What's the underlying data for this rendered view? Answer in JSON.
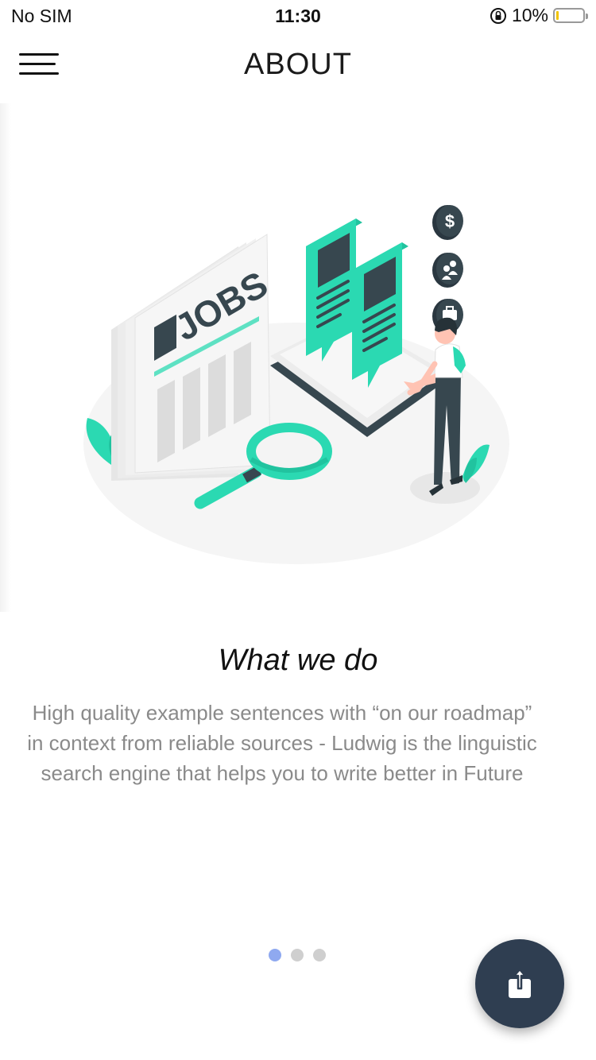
{
  "status_bar": {
    "carrier": "No SIM",
    "time": "11:30",
    "battery_percent": "10%",
    "battery_level": 0.1
  },
  "header": {
    "title": "ABOUT"
  },
  "hero": {
    "sign_text": "JOBS",
    "accent": "#2bd9b2",
    "dark": "#37474f"
  },
  "content": {
    "title": "What we do",
    "description": "High quality example sentences with “on our roadmap” in context from reliable sources - Ludwig is the linguistic search engine that helps you to write better in Future"
  },
  "pager": {
    "count": 3,
    "active_index": 0
  },
  "fab": {
    "icon": "share-icon",
    "color": "#2f3e51"
  }
}
